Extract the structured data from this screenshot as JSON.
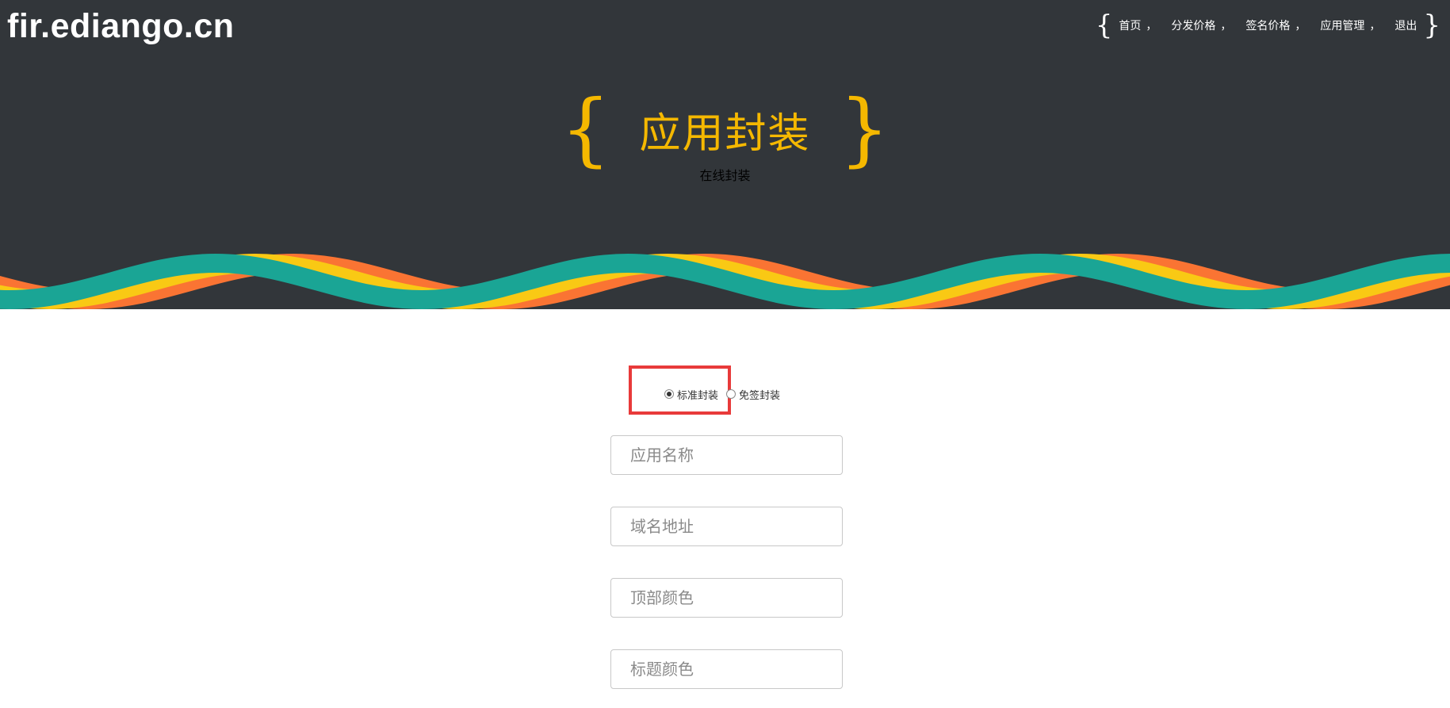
{
  "site": {
    "logo": "fir.ediango.cn"
  },
  "nav": {
    "open_brace": "{",
    "close_brace": "}",
    "items": [
      {
        "label": "首页"
      },
      {
        "label": "分发价格"
      },
      {
        "label": "签名价格"
      },
      {
        "label": "应用管理"
      },
      {
        "label": "退出"
      }
    ],
    "separator": "，"
  },
  "hero": {
    "open_brace": "{",
    "close_brace": "}",
    "title": "应用封装",
    "subtitle": "在线封装"
  },
  "form": {
    "package_type": {
      "options": [
        {
          "label": "标准封装",
          "checked": true
        },
        {
          "label": "免签封装",
          "checked": false
        }
      ]
    },
    "fields": [
      {
        "placeholder": "应用名称",
        "value": ""
      },
      {
        "placeholder": "域名地址",
        "value": ""
      },
      {
        "placeholder": "顶部颜色",
        "value": ""
      },
      {
        "placeholder": "标题颜色",
        "value": ""
      }
    ]
  },
  "colors": {
    "header_bg": "#32363a",
    "accent_yellow": "#f5b800",
    "wave_teal": "#1aa595",
    "wave_yellow": "#f9c914",
    "wave_orange": "#fa7433",
    "highlight_red": "#e83a3a"
  }
}
